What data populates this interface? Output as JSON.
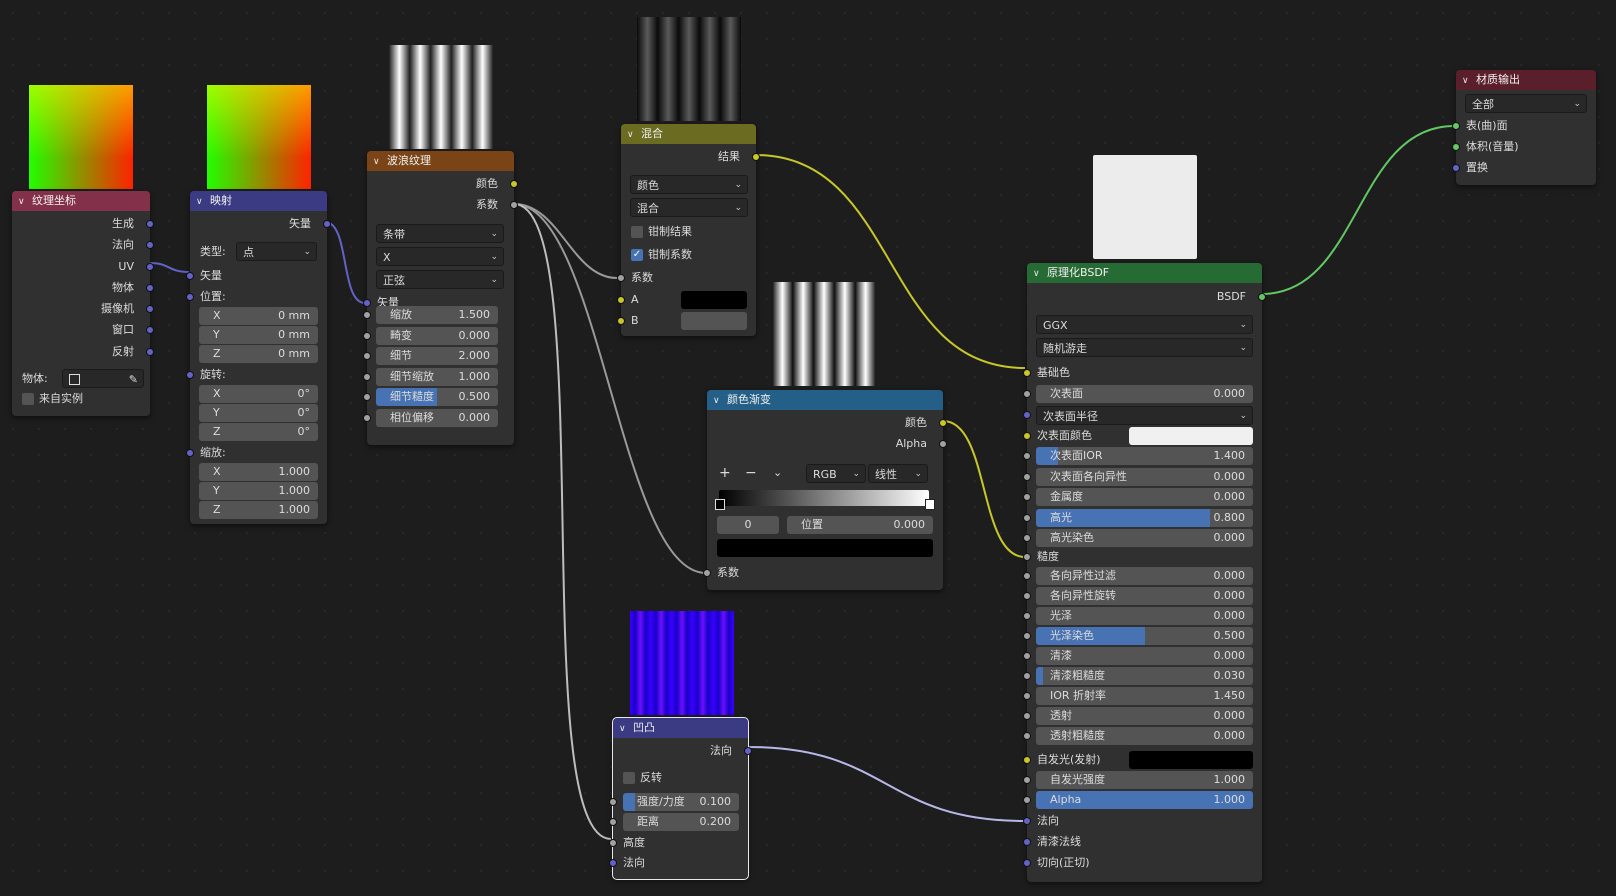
{
  "colors": {
    "texcoord_header": "#83314a",
    "vector_header": "#3b3b84",
    "texture_header": "#7a4416",
    "color_header": "#6b6b21",
    "converter_header": "#245f87",
    "shader_header": "#276b34",
    "output_header": "#5a1f2b",
    "socket_color": "#c7c729",
    "socket_float": "#a1a1a1",
    "socket_vector": "#6363c7",
    "socket_shader": "#63c763",
    "field_fill": "#4772b3"
  },
  "texcoord": {
    "title": "纹理坐标",
    "outputs": [
      "生成",
      "法向",
      "UV",
      "物体",
      "摄像机",
      "窗口",
      "反射"
    ],
    "object_label": "物体:",
    "from_instancer": "来自实例",
    "icons": [
      "object-cube-icon",
      "eyedropper-icon"
    ]
  },
  "mapping": {
    "title": "映射",
    "output": "矢量",
    "type_label": "类型:",
    "type_value": "点",
    "vector_label": "矢量",
    "location_label": "位置:",
    "location": [
      {
        "axis": "X",
        "value": "0 mm"
      },
      {
        "axis": "Y",
        "value": "0 mm"
      },
      {
        "axis": "Z",
        "value": "0 mm"
      }
    ],
    "rotation_label": "旋转:",
    "rotation": [
      {
        "axis": "X",
        "value": "0°"
      },
      {
        "axis": "Y",
        "value": "0°"
      },
      {
        "axis": "Z",
        "value": "0°"
      }
    ],
    "scale_label": "缩放:",
    "scale": [
      {
        "axis": "X",
        "value": "1.000"
      },
      {
        "axis": "Y",
        "value": "1.000"
      },
      {
        "axis": "Z",
        "value": "1.000"
      }
    ]
  },
  "wave": {
    "title": "波浪纹理",
    "out_color": "颜色",
    "out_fac": "系数",
    "type": "条带",
    "direction": "X",
    "profile": "正弦",
    "vector_label": "矢量",
    "fields": [
      {
        "label": "缩放",
        "value": "1.500",
        "fill": 0
      },
      {
        "label": "畸变",
        "value": "0.000",
        "fill": 0
      },
      {
        "label": "细节",
        "value": "2.000",
        "fill": 0
      },
      {
        "label": "细节缩放",
        "value": "1.000",
        "fill": 0
      },
      {
        "label": "细节糙度",
        "value": "0.500",
        "fill": 0.5
      },
      {
        "label": "相位偏移",
        "value": "0.000",
        "fill": 0
      }
    ]
  },
  "mix": {
    "title": "混合",
    "out_result": "结果",
    "data_type": "颜色",
    "blend": "混合",
    "clamp_result": "钳制结果",
    "clamp_factor": "钳制系数",
    "clamp_result_checked": false,
    "clamp_factor_checked": true,
    "in_factor": "系数",
    "in_a": "A",
    "in_b": "B",
    "a_color": "#000000",
    "b_color": "#545454"
  },
  "ramp": {
    "title": "颜色渐变",
    "out_color": "颜色",
    "out_alpha": "Alpha",
    "add": "+",
    "remove": "−",
    "mode": "RGB",
    "interp": "线性",
    "index": "0",
    "pos_label": "位置",
    "pos_value": "0.000",
    "in_fac": "系数",
    "stop_color": "#000000"
  },
  "bump": {
    "title": "凹凸",
    "out_normal": "法向",
    "invert": "反转",
    "strength_label": "强度/力度",
    "strength_value": "0.100",
    "strength_fill": 0.1,
    "distance_label": "距离",
    "distance_value": "0.200",
    "in_height": "高度",
    "in_normal": "法向"
  },
  "bsdf": {
    "title": "原理化BSDF",
    "out": "BSDF",
    "distribution": "GGX",
    "subsurface_method": "随机游走",
    "base_color": "基础色",
    "subsurface_radius": "次表面半径",
    "subsurface_color": "次表面颜色",
    "subsurface_color_value": "#f0f0f0",
    "roughness": "糙度",
    "emission": "自发光(发射)",
    "emission_color": "#000000",
    "normal": "法向",
    "clearcoat_normal": "清漆法线",
    "tangent": "切向(正切)",
    "fields_a": [
      {
        "label": "次表面",
        "value": "0.000",
        "fill": 0
      }
    ],
    "fields_b": [
      {
        "label": "次表面IOR",
        "value": "1.400",
        "fill": 0.1
      },
      {
        "label": "次表面各向异性",
        "value": "0.000",
        "fill": 0
      },
      {
        "label": "金属度",
        "value": "0.000",
        "fill": 0
      },
      {
        "label": "高光",
        "value": "0.800",
        "fill": 0.8
      },
      {
        "label": "高光染色",
        "value": "0.000",
        "fill": 0
      }
    ],
    "fields_c": [
      {
        "label": "各向异性过滤",
        "value": "0.000",
        "fill": 0
      },
      {
        "label": "各向异性旋转",
        "value": "0.000",
        "fill": 0
      },
      {
        "label": "光泽",
        "value": "0.000",
        "fill": 0
      },
      {
        "label": "光泽染色",
        "value": "0.500",
        "fill": 0.5
      },
      {
        "label": "清漆",
        "value": "0.000",
        "fill": 0
      },
      {
        "label": "清漆粗糙度",
        "value": "0.030",
        "fill": 0.03
      },
      {
        "label": "IOR 折射率",
        "value": "1.450",
        "fill": 0
      },
      {
        "label": "透射",
        "value": "0.000",
        "fill": 0
      },
      {
        "label": "透射粗糙度",
        "value": "0.000",
        "fill": 0
      }
    ],
    "fields_d": [
      {
        "label": "自发光强度",
        "value": "1.000",
        "fill": 0
      },
      {
        "label": "Alpha",
        "value": "1.000",
        "fill": 1
      }
    ]
  },
  "output": {
    "title": "材质输出",
    "target": "全部",
    "inputs": [
      "表(曲)面",
      "体积(音量)",
      "置换"
    ]
  }
}
